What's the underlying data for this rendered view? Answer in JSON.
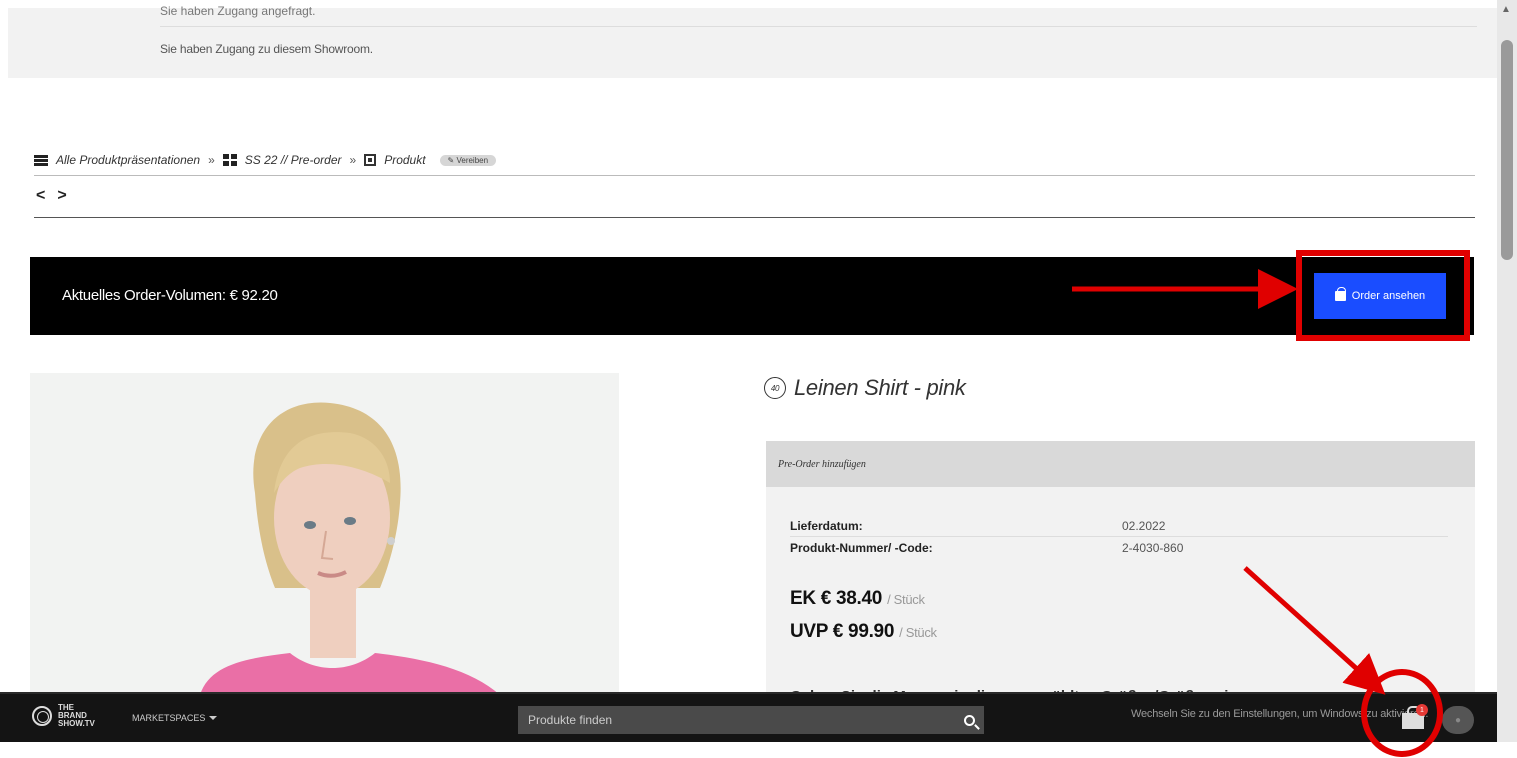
{
  "info_box": {
    "line_cut": "Sie haben Zugang angefragt.",
    "line": "Sie haben Zugang zu diesem Showroom."
  },
  "breadcrumb": {
    "item1": "Alle Produktpräsentationen",
    "item2": "SS 22 // Pre-order",
    "item3": "Produkt",
    "separator": "»",
    "badge": "✎ Vereiben"
  },
  "nav": {
    "prev": "<",
    "next": ">"
  },
  "order_bar": {
    "volume_text": "Aktuelles Order-Volumen: € 92.20",
    "button_label": "Order ansehen"
  },
  "product": {
    "size_badge": "40",
    "title": "Leinen Shirt - pink",
    "panel_header": "Pre-Order hinzufügen",
    "details": [
      {
        "key": "Lieferdatum:",
        "value": "02.2022"
      },
      {
        "key": "Produkt-Nummer/ -Code:",
        "value": "2-4030-860"
      }
    ],
    "price_ek": {
      "label": "EK € 38.40",
      "unit": "/ Stück"
    },
    "price_uvp": {
      "label": "UVP € 99.90",
      "unit": "/ Stück"
    },
    "cut_text": "Geben Sie die Mengen in die ausgewählten Größen/Größen ein"
  },
  "bottom_bar": {
    "logo_line1": "THE",
    "logo_line2": "BRAND",
    "logo_line3": "SHOW.TV",
    "marketspaces": "MARKETSPACES",
    "search_placeholder": "Produkte finden",
    "watermark": "Wechseln Sie zu den Einstellungen, um Windows zu aktivieren.",
    "cart_count": "1"
  },
  "colors": {
    "accent_blue": "#1a4dff",
    "annotation_red": "#e00000",
    "order_bar_bg": "#000000",
    "bottom_bar_bg": "#141414"
  }
}
